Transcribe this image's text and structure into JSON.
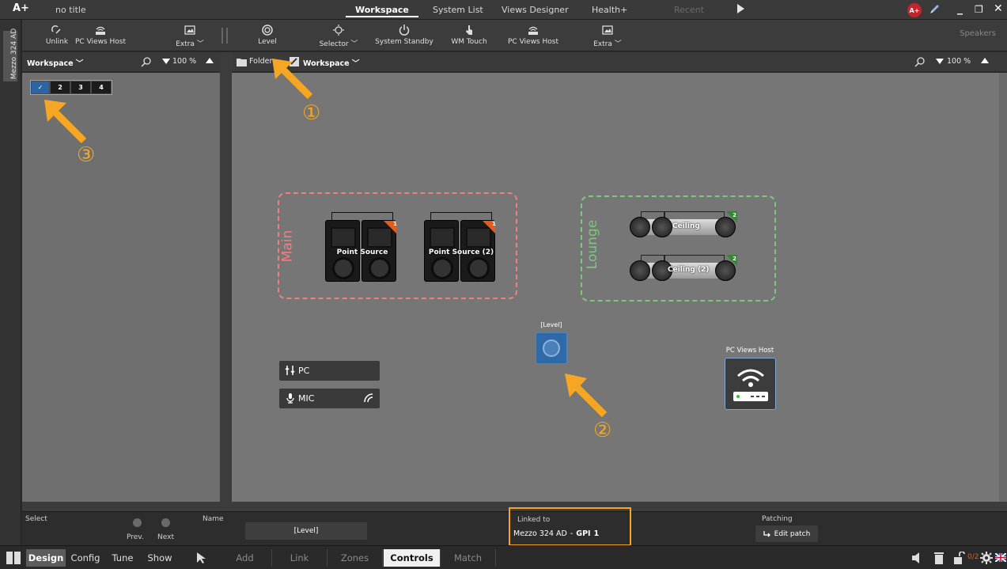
{
  "titlebar": {
    "logo": "A+",
    "doc_title": "no title",
    "tabs": [
      {
        "label": "Workspace",
        "state": "active"
      },
      {
        "label": "System List",
        "state": "normal"
      },
      {
        "label": "Views Designer",
        "state": "normal"
      },
      {
        "label": "Health+",
        "state": "normal"
      },
      {
        "label": "Recent",
        "state": "disabled"
      }
    ],
    "avatar_text": "A+",
    "controls": {
      "minimize": "_",
      "restore": "❐",
      "close": "✕"
    }
  },
  "device_strip": {
    "device_name": "Mezzo 324 AD"
  },
  "toolbar": {
    "left_tools": [
      {
        "label": "Unlink",
        "icon": "unlink-icon"
      },
      {
        "label": "PC Views Host",
        "icon": "router-icon"
      },
      {
        "label": "Extra ﹀",
        "icon": "image-icon"
      }
    ],
    "right_tools": [
      {
        "label": "Level",
        "icon": "knob-icon"
      },
      {
        "label": "Selector ﹀",
        "icon": "dial-icon"
      },
      {
        "label": "System Standby",
        "icon": "power-icon"
      },
      {
        "label": "WM Touch",
        "icon": "touch-icon"
      },
      {
        "label": "PC Views Host",
        "icon": "router-icon"
      },
      {
        "label": "Extra ﹀",
        "icon": "image-icon"
      }
    ],
    "speakers_label": "Speakers"
  },
  "left_header": {
    "workspace": "Workspace ﹀",
    "zoom": "100 %"
  },
  "page_tabs": [
    "✓",
    "2",
    "3",
    "4"
  ],
  "main_header": {
    "folder": "Folder",
    "workspace": "Workspace ﹀",
    "zoom": "100 %"
  },
  "canvas": {
    "zones": [
      {
        "label": "Main",
        "color": "#f08080"
      },
      {
        "label": "Lounge",
        "color": "#7cc87c"
      }
    ],
    "point_sources": [
      {
        "name": "Point Source",
        "badge": "1"
      },
      {
        "name": "Point Source (2)",
        "badge": "1"
      }
    ],
    "ceilings": [
      {
        "name": "Ceiling",
        "badge": "2"
      },
      {
        "name": "Ceiling (2)",
        "badge": "2"
      }
    ],
    "inputs": [
      {
        "label": "PC",
        "icon": "io-icon"
      },
      {
        "label": "MIC",
        "icon": "mic-icon"
      }
    ],
    "level_widget": {
      "label": "[Level]"
    },
    "pc_views_host": {
      "label": "PC Views Host"
    },
    "markers": [
      "①",
      "②",
      "③"
    ]
  },
  "props": {
    "select_label": "Select",
    "prev_label": "Prev.",
    "next_label": "Next",
    "name_label": "Name",
    "name_value": "[Level]",
    "linked_label": "Linked to",
    "linked_device": "Mezzo 324 AD",
    "linked_sep": "-",
    "linked_gpi": "GPI",
    "linked_gpi_num": "1",
    "patching_label": "Patching",
    "edit_patch_label": "Edit patch"
  },
  "bottombar": {
    "modes": [
      {
        "label": "Design",
        "active": true
      },
      {
        "label": "Config",
        "active": false
      },
      {
        "label": "Tune",
        "active": false
      },
      {
        "label": "Show",
        "active": false
      }
    ],
    "subtabs": [
      {
        "label": "Add",
        "active": false
      },
      {
        "label": "Link",
        "active": false
      },
      {
        "label": "Zones",
        "active": false
      },
      {
        "label": "Controls",
        "active": true
      },
      {
        "label": "Match",
        "active": false
      }
    ],
    "counter": "0/2"
  },
  "colors": {
    "accent_blue": "#2f6aa8",
    "annotation": "#f5a623",
    "badge_orange": "#e65a1e",
    "badge_green": "#2f8a2f"
  }
}
